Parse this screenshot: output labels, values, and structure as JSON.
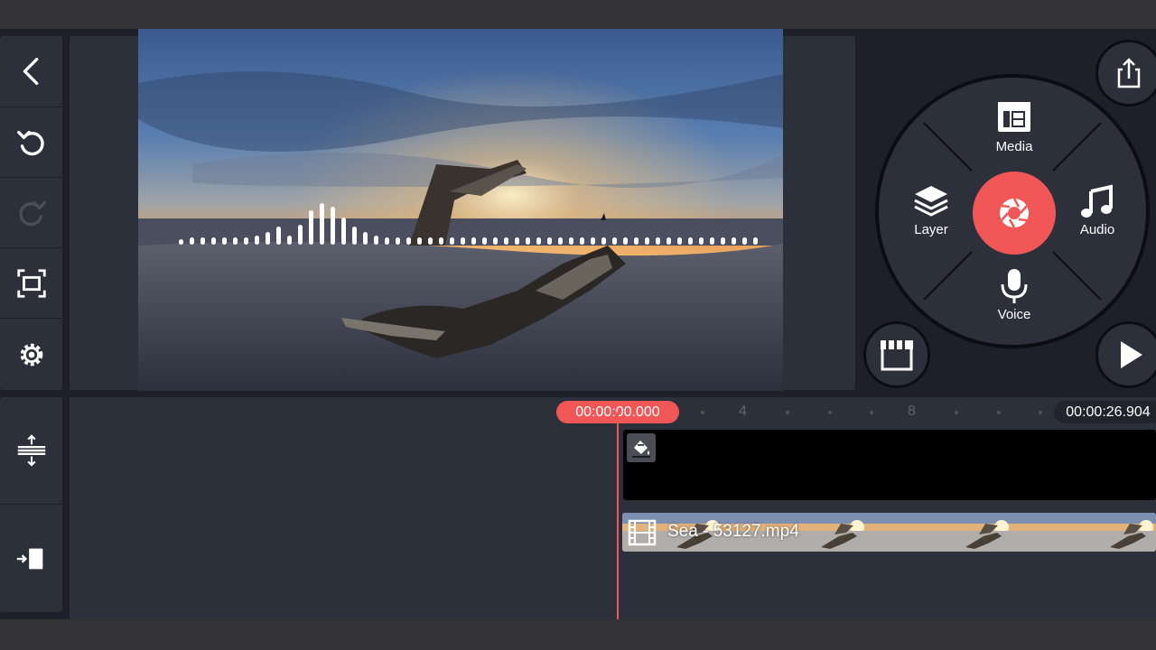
{
  "sidebar": {
    "buttons": [
      {
        "name": "back-button",
        "icon": "back-arrow-icon"
      },
      {
        "name": "undo-button",
        "icon": "undo-icon"
      },
      {
        "name": "redo-button",
        "icon": "redo-icon",
        "disabled": true
      },
      {
        "name": "aspect-button",
        "icon": "fullscreen-frame-icon"
      },
      {
        "name": "settings-button",
        "icon": "gear-icon"
      },
      {
        "name": "track-height-button",
        "icon": "expand-tracks-icon"
      },
      {
        "name": "jump-to-end-button",
        "icon": "jump-end-icon"
      }
    ]
  },
  "wheel": {
    "media_label": "Media",
    "layer_label": "Layer",
    "audio_label": "Audio",
    "voice_label": "Voice",
    "center_icon": "camera-shutter-icon"
  },
  "actions": {
    "share_icon": "share-icon",
    "store_icon": "store-icon",
    "play_icon": "play-icon"
  },
  "timeline": {
    "current_time": "00:00:00.000",
    "total_time": "00:00:26.904",
    "ruler_labels": [
      "4",
      "8"
    ],
    "clip_name": "Sea - 53127.mp4",
    "background_track_icon": "paint-bucket-icon"
  },
  "colors": {
    "accent": "#f25758",
    "panel": "#2c303b",
    "background": "#1d2029"
  }
}
